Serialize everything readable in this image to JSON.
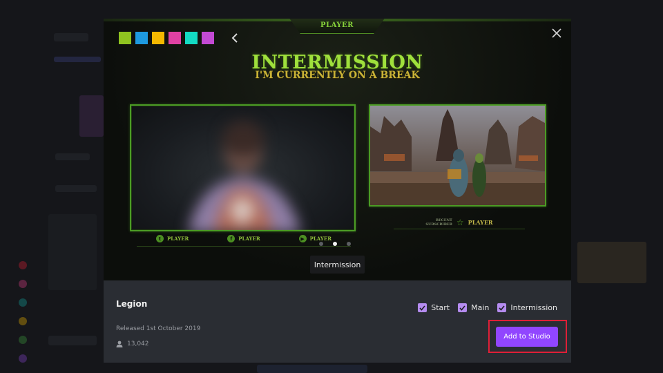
{
  "modal": {
    "banner_text": "PLAYER",
    "swatch_colors": [
      "#8fc320",
      "#1e9ae0",
      "#f4b800",
      "#e041a3",
      "#13dbc3",
      "#c34ad4"
    ],
    "icons": {
      "prev": "chevron-left-icon",
      "close": "close-icon",
      "user": "user-icon",
      "check": "checkmark-icon"
    },
    "preview": {
      "heading": "INTERMISSION",
      "subheading": "I'M CURRENTLY ON A BREAK",
      "cam_socials": [
        {
          "icon": "twitter-icon",
          "glyph": "t",
          "label": "PLAYER"
        },
        {
          "icon": "facebook-icon",
          "glyph": "f",
          "label": "PLAYER"
        },
        {
          "icon": "youtube-icon",
          "glyph": "▶",
          "label": "PLAYER"
        }
      ],
      "recent_line1": "RECENT",
      "recent_line2": "SUBSCRIBER",
      "recent_name": "PLAYER",
      "slide_count": 3,
      "active_slide": 2,
      "tooltip": "Intermission"
    },
    "info": {
      "title": "Legion",
      "released": "Released 1st October 2019",
      "user_count": "13,042",
      "checkboxes": [
        {
          "label": "Start",
          "checked": true
        },
        {
          "label": "Main",
          "checked": true
        },
        {
          "label": "Intermission",
          "checked": true
        }
      ],
      "cta_label": "Add to Studio"
    },
    "accent_colors": {
      "frame_green": "#4c9c25",
      "title_green": "#9fe03c",
      "subtitle_gold": "#c9b236",
      "checkbox_purple": "#b58cf0",
      "cta_purple": "#9146ff",
      "highlight_red": "#e01f37"
    }
  }
}
